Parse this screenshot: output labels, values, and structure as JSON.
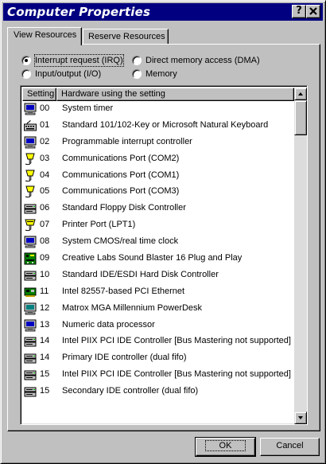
{
  "window": {
    "title": "Computer Properties"
  },
  "titlebar_buttons": {
    "help": "?",
    "close": "X"
  },
  "tabs": [
    {
      "label": "View Resources",
      "active": true
    },
    {
      "label": "Reserve Resources",
      "active": false
    }
  ],
  "view_options": [
    {
      "label": "Interrupt request (IRQ)",
      "selected": true
    },
    {
      "label": "Direct memory access (DMA)",
      "selected": false
    },
    {
      "label": "Input/output (I/O)",
      "selected": false
    },
    {
      "label": "Memory",
      "selected": false
    }
  ],
  "table": {
    "columns": [
      "Setting",
      "Hardware using the setting"
    ],
    "rows": [
      {
        "setting": "00",
        "hardware": "System timer",
        "icon": "computer-icon"
      },
      {
        "setting": "01",
        "hardware": "Standard 101/102-Key or Microsoft Natural Keyboard",
        "icon": "keyboard-icon"
      },
      {
        "setting": "02",
        "hardware": "Programmable interrupt controller",
        "icon": "computer-icon"
      },
      {
        "setting": "03",
        "hardware": "Communications Port (COM2)",
        "icon": "port-icon"
      },
      {
        "setting": "04",
        "hardware": "Communications Port (COM1)",
        "icon": "port-icon"
      },
      {
        "setting": "05",
        "hardware": "Communications Port (COM3)",
        "icon": "port-icon"
      },
      {
        "setting": "06",
        "hardware": "Standard Floppy Disk Controller",
        "icon": "drive-controller-icon"
      },
      {
        "setting": "07",
        "hardware": "Printer Port (LPT1)",
        "icon": "printer-port-icon"
      },
      {
        "setting": "08",
        "hardware": "System CMOS/real time clock",
        "icon": "computer-icon"
      },
      {
        "setting": "09",
        "hardware": "Creative Labs Sound Blaster 16 Plug and Play",
        "icon": "sound-icon"
      },
      {
        "setting": "10",
        "hardware": "Standard IDE/ESDI Hard Disk Controller",
        "icon": "drive-controller-icon"
      },
      {
        "setting": "11",
        "hardware": "Intel 82557-based PCI Ethernet",
        "icon": "network-card-icon"
      },
      {
        "setting": "12",
        "hardware": "Matrox MGA Millennium PowerDesk",
        "icon": "monitor-icon"
      },
      {
        "setting": "13",
        "hardware": "Numeric data processor",
        "icon": "computer-icon"
      },
      {
        "setting": "14",
        "hardware": "Intel PIIX PCI IDE Controller [Bus Mastering not supported]",
        "icon": "drive-controller-icon"
      },
      {
        "setting": "14",
        "hardware": "Primary IDE controller (dual fifo)",
        "icon": "drive-controller-icon"
      },
      {
        "setting": "15",
        "hardware": "Intel PIIX PCI IDE Controller [Bus Mastering not supported]",
        "icon": "drive-controller-icon"
      },
      {
        "setting": "15",
        "hardware": "Secondary IDE controller (dual fifo)",
        "icon": "drive-controller-icon"
      }
    ]
  },
  "buttons": {
    "ok": "OK",
    "cancel": "Cancel"
  },
  "colors": {
    "titlebar": "#000080",
    "face": "#c0c0c0",
    "list_bg": "#ffffff"
  }
}
